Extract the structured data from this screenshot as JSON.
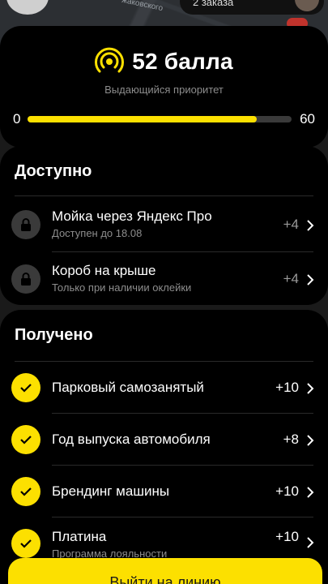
{
  "map": {
    "street_fragment": "жаковского",
    "orders_pill": "2 заказа"
  },
  "priority": {
    "score": "52 балла",
    "subtitle": "Выдающийся приоритет",
    "progress_min": "0",
    "progress_max": "60",
    "progress_value": 52
  },
  "available": {
    "title": "Доступно",
    "items": [
      {
        "title": "Мойка через Яндекс Про",
        "subtitle": "Доступен до 18.08",
        "points": "+4"
      },
      {
        "title": "Короб на крыше",
        "subtitle": "Только при наличии оклейки",
        "points": "+4"
      }
    ]
  },
  "received": {
    "title": "Получено",
    "items": [
      {
        "title": "Парковый самозанятый",
        "subtitle": "",
        "points": "+10"
      },
      {
        "title": "Год выпуска автомобиля",
        "subtitle": "",
        "points": "+8"
      },
      {
        "title": "Брендинг машины",
        "subtitle": "",
        "points": "+10"
      },
      {
        "title": "Платина",
        "subtitle": "Программа лояльности",
        "points": "+10"
      }
    ]
  },
  "cta": {
    "label": "Выйти на линию"
  },
  "colors": {
    "accent": "#fce000",
    "card": "#000000",
    "muted": "#8d8d8d"
  },
  "icons": {
    "priority": "radio-waves-icon",
    "locked": "lock-icon",
    "done": "check-icon",
    "more": "chevron-right-icon"
  }
}
